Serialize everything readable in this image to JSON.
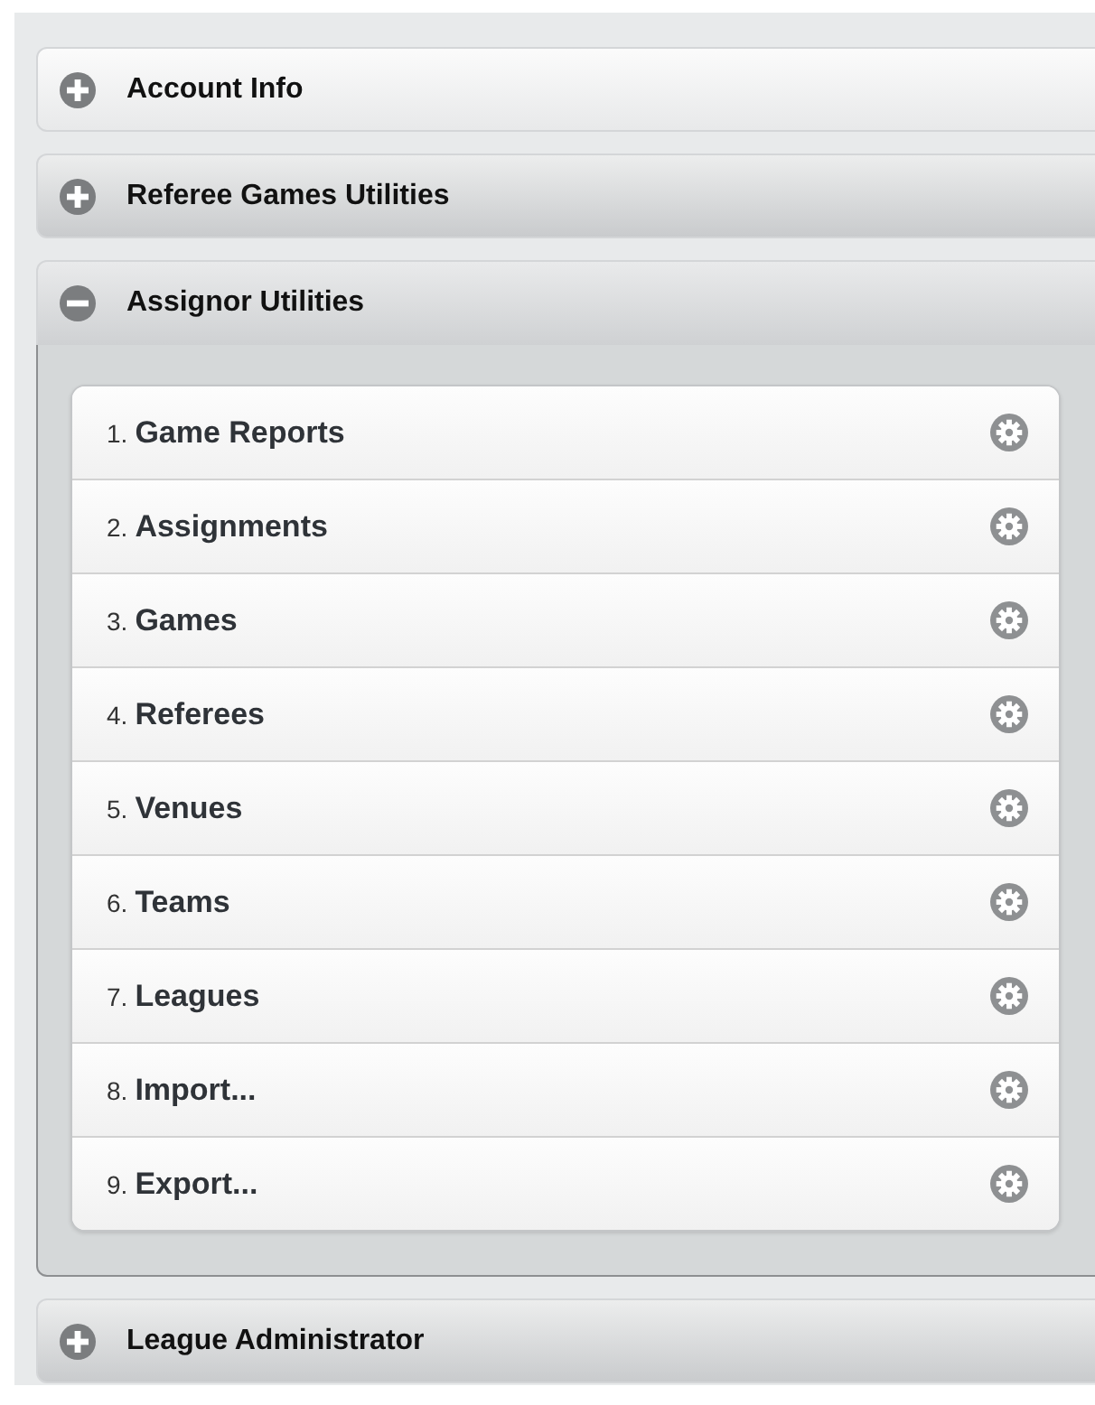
{
  "sections": [
    {
      "title": "Account Info",
      "expanded": false
    },
    {
      "title": "Referee Games Utilities",
      "expanded": false
    },
    {
      "title": "Assignor Utilities",
      "expanded": true,
      "items": [
        {
          "number": "1.",
          "label": "Game Reports"
        },
        {
          "number": "2.",
          "label": "Assignments"
        },
        {
          "number": "3.",
          "label": "Games"
        },
        {
          "number": "4.",
          "label": "Referees"
        },
        {
          "number": "5.",
          "label": "Venues"
        },
        {
          "number": "6.",
          "label": "Teams"
        },
        {
          "number": "7.",
          "label": "Leagues"
        },
        {
          "number": "8.",
          "label": "Import..."
        },
        {
          "number": "9.",
          "label": "Export..."
        }
      ]
    },
    {
      "title": "League Administrator",
      "expanded": false
    }
  ]
}
